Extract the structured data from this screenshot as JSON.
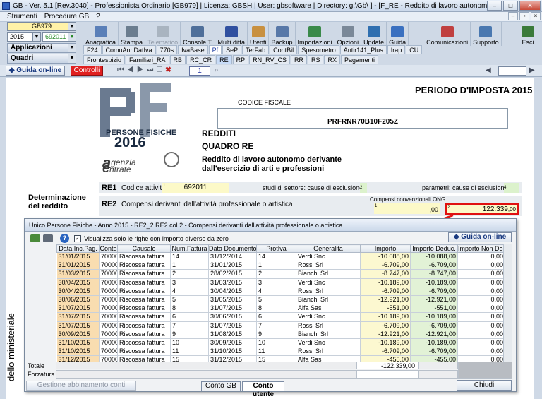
{
  "window": {
    "title": "GB - Ver. 5.1 [Rev.3040] - Professionista Ordinario [GB979]   | Licenza: GBSH | User: gbsoftware | Directory: g:\\Gb\\ ] - [F_RE - Reddito di lavoro autonomi]",
    "min": "–",
    "max": "□",
    "close": "✕"
  },
  "menu": {
    "items": [
      "Strumenti",
      "Procedure GB",
      "?"
    ],
    "restore": "–",
    "maxi": "▫",
    "close": "×"
  },
  "left": {
    "company": "GB979",
    "year": "2015",
    "code": "692011 -",
    "applicazioni": "Applicazioni",
    "quadri": "Quadri"
  },
  "toolbar": {
    "buttons": [
      {
        "label": "Anagrafica",
        "icon": "anagrafica-icon",
        "color": "#5a7fb8"
      },
      {
        "label": "Stampa",
        "icon": "printer-icon",
        "color": "#6b7d8f"
      },
      {
        "label": "Telematico",
        "icon": "telematico-icon",
        "color": "#a9b4c0"
      },
      {
        "label": "Console T.",
        "icon": "console-icon",
        "color": "#4f6f9a"
      },
      {
        "label": "Multi ditta",
        "icon": "multi-ditta-icon",
        "color": "#3050a0"
      },
      {
        "label": "Utenti",
        "icon": "users-icon",
        "color": "#c89040"
      },
      {
        "label": "Backup",
        "icon": "backup-icon",
        "color": "#5878a8"
      },
      {
        "label": "Importazioni",
        "icon": "import-icon",
        "color": "#3a8a4a"
      },
      {
        "label": "Opzioni",
        "icon": "options-icon",
        "color": "#7a8898"
      },
      {
        "label": "Update",
        "icon": "update-icon",
        "color": "#2f6fb0"
      },
      {
        "label": "Guida",
        "icon": "help-icon",
        "color": "#3a70c0"
      },
      {
        "label": "Comunicazioni",
        "icon": "communications-icon",
        "color": "#c04040"
      },
      {
        "label": "Supporto",
        "icon": "support-icon",
        "color": "#4a78b0"
      }
    ],
    "exit": "Esci"
  },
  "apps_tabs": [
    "F24",
    "ComuAnnDatIva",
    "770s",
    "IvaBase",
    "Pf",
    "SeP",
    "TerFab",
    "ContBil",
    "Spesometro",
    "Antir141_Plus",
    "Irap",
    "CU"
  ],
  "quadri_tabs": [
    "Frontespizio",
    "Familiari_RA",
    "RB",
    "RC_CR",
    "RE",
    "RP",
    "RN_RV_CS",
    "RR",
    "RS",
    "RX",
    "Pagamenti"
  ],
  "navbar": {
    "guida": "Guida on-line",
    "controlli": "Controlli",
    "page": "1"
  },
  "form": {
    "periodo": "PERIODO D'IMPOSTA 2015",
    "cf_label": "CODICE FISCALE",
    "cf_value": "PRFRNR70B10F205Z",
    "logo_line1": "PERSONE FISICHE",
    "logo_year": "2016",
    "logo_agenzia": "genzia",
    "logo_entrate": "ntrate",
    "redditi": "REDDITI",
    "quadro": "QUADRO RE",
    "desc1": "Reddito di lavoro autonomo derivante",
    "desc2": "dall'esercizio di arti e professioni",
    "re1": {
      "code": "RE1",
      "label": "Codice attività",
      "n1": "1",
      "value": "692011",
      "studi": "studi di settore: cause di esclusione",
      "n2": "2",
      "parametri": "parametri: cause di esclusione",
      "n4": "4"
    },
    "det_label1": "Determinazione",
    "det_label2": "del reddito",
    "re2": {
      "code": "RE2",
      "label": "Compensi derivanti dall'attività professionale o artistica",
      "ong": "Compensi convenzionali ONG",
      "n1": "1",
      "v1": ",00",
      "n2": "2",
      "v2": "122.339",
      "v2dec": ",00"
    },
    "vertical": "dello ministeriale"
  },
  "dialog": {
    "title": "Unico Persone Fisiche - Anno 2015 - RE2_2 RE2 col.2 - Compensi derivanti dall'attività professionale o artistica",
    "checkbox_label": "Visualizza solo le righe con importo diverso da zero",
    "guida": "Guida on-line",
    "columns": [
      "Data Inc.Pag.",
      "Conto",
      "Causale",
      "Num.Fattura",
      "Data Documento",
      "ProtIva",
      "Generalita",
      "Importo",
      "Importo Deduc.",
      "Importo Non Deduc."
    ],
    "rows": [
      [
        "31/01/2015",
        "70000",
        "Riscossa fattura",
        "14",
        "31/12/2014",
        "14",
        "Verdi Snc",
        "-10.088,00",
        "-10.088,00",
        "0,00"
      ],
      [
        "31/01/2015",
        "70000",
        "Riscossa fattura",
        "1",
        "31/01/2015",
        "1",
        "Rossi Srl",
        "-6.709,00",
        "-6.709,00",
        "0,00"
      ],
      [
        "31/03/2015",
        "70000",
        "Riscossa fattura",
        "2",
        "28/02/2015",
        "2",
        "Bianchi Srl",
        "-8.747,00",
        "-8.747,00",
        "0,00"
      ],
      [
        "30/04/2015",
        "70000",
        "Riscossa fattura",
        "3",
        "31/03/2015",
        "3",
        "Verdi Snc",
        "-10.189,00",
        "-10.189,00",
        "0,00"
      ],
      [
        "30/04/2015",
        "70000",
        "Riscossa fattura",
        "4",
        "30/04/2015",
        "4",
        "Rossi Srl",
        "-6.709,00",
        "-6.709,00",
        "0,00"
      ],
      [
        "30/06/2015",
        "70000",
        "Riscossa fattura",
        "5",
        "31/05/2015",
        "5",
        "Bianchi Srl",
        "-12.921,00",
        "-12.921,00",
        "0,00"
      ],
      [
        "31/07/2015",
        "70000",
        "Riscossa fattura",
        "8",
        "31/07/2015",
        "8",
        "Alfa Sas",
        "-551,00",
        "-551,00",
        "0,00"
      ],
      [
        "31/07/2015",
        "70000",
        "Riscossa fattura",
        "6",
        "30/06/2015",
        "6",
        "Verdi Snc",
        "-10.189,00",
        "-10.189,00",
        "0,00"
      ],
      [
        "31/07/2015",
        "70000",
        "Riscossa fattura",
        "7",
        "31/07/2015",
        "7",
        "Rossi Srl",
        "-6.709,00",
        "-6.709,00",
        "0,00"
      ],
      [
        "30/09/2015",
        "70000",
        "Riscossa fattura",
        "9",
        "31/08/2015",
        "9",
        "Bianchi Srl",
        "-12.921,00",
        "-12.921,00",
        "0,00"
      ],
      [
        "31/10/2015",
        "70000",
        "Riscossa fattura",
        "10",
        "30/09/2015",
        "10",
        "Verdi Snc",
        "-10.189,00",
        "-10.189,00",
        "0,00"
      ],
      [
        "31/10/2015",
        "70000",
        "Riscossa fattura",
        "11",
        "31/10/2015",
        "11",
        "Rossi Srl",
        "-6.709,00",
        "-6.709,00",
        "0,00"
      ],
      [
        "31/12/2015",
        "70000",
        "Riscossa fattura",
        "15",
        "31/12/2015",
        "15",
        "Alfa Sas",
        "-455,00",
        "-455,00",
        "0,00"
      ]
    ],
    "totale_label": "Totale",
    "totale_value": "-122.339,00",
    "forzatura_label": "Forzatura",
    "gestione": "Gestione abbinamento conti",
    "tab_conto_gb": "Conto GB",
    "tab_conto_utente": "Conto utente",
    "chiudi": "Chiudi"
  }
}
